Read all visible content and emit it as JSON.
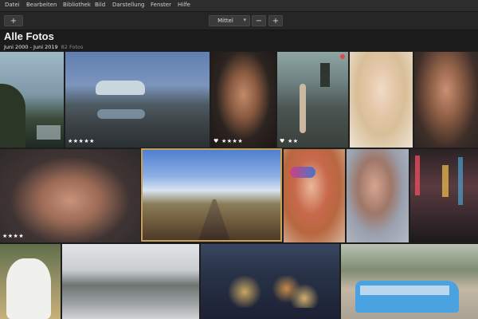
{
  "menu": [
    "Datei",
    "Bearbeiten",
    "Bibliothek",
    "Bild",
    "Darstellung",
    "Fenster",
    "Hilfe"
  ],
  "toolbar": {
    "add_label": "+",
    "size_value": "Mittel",
    "zoom_out_label": "−",
    "zoom_in_label": "+"
  },
  "header": {
    "title": "Alle Fotos",
    "date_range": "Juni 2000 - Juni 2019",
    "photo_count": "82 Fotos"
  },
  "photos": [
    {
      "subject": "cliff jump over water",
      "stars": "",
      "heart": false
    },
    {
      "subject": "vintage convertible car at lake",
      "stars": "★★★★★",
      "heart": false
    },
    {
      "subject": "portrait woman",
      "stars": "★★★★",
      "heart": true
    },
    {
      "subject": "woman at castle",
      "stars": "★★",
      "heart": true,
      "flagged": true
    },
    {
      "subject": "blonde woman portrait",
      "stars": "",
      "heart": false
    },
    {
      "subject": "woman hand on chin",
      "stars": "",
      "heart": false
    },
    {
      "subject": "woman portrait dark background",
      "stars": "★★★★",
      "heart": false
    },
    {
      "subject": "railway tracks landscape",
      "stars": "",
      "heart": false,
      "selected": true
    },
    {
      "subject": "colorful makeup portrait",
      "stars": "",
      "heart": false
    },
    {
      "subject": "woman portrait gray",
      "stars": "",
      "heart": false
    },
    {
      "subject": "neon city street",
      "stars": "",
      "heart": false
    },
    {
      "subject": "white dog",
      "stars": "",
      "heart": false
    },
    {
      "subject": "snowy forest lake",
      "stars": "",
      "heart": false
    },
    {
      "subject": "city lights aerial",
      "stars": "",
      "heart": false
    },
    {
      "subject": "blue van palm trees",
      "stars": "",
      "heart": false
    }
  ]
}
